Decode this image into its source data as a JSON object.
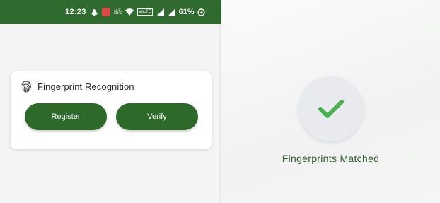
{
  "status_bar": {
    "time": "12:23",
    "speed_top": "17.0",
    "speed_bottom": "KB/S",
    "volte": "VoLTE",
    "battery": "61%",
    "icons": [
      "snapchat-icon",
      "app-notification-icon",
      "data-speed",
      "wifi-icon",
      "volte-icon",
      "signal-icon",
      "signal-icon",
      "battery-saver-icon"
    ],
    "colors": {
      "background": "#2f6a2e"
    }
  },
  "card": {
    "icon": "fingerprint-icon",
    "title": "Fingerprint Recognition",
    "register_label": "Register",
    "verify_label": "Verify"
  },
  "result": {
    "icon": "checkmark-icon",
    "message": "Fingerprints Matched",
    "colors": {
      "check": "#4caf50",
      "text": "#2f5c2d"
    }
  },
  "colors": {
    "accent": "#2d6a2a"
  }
}
